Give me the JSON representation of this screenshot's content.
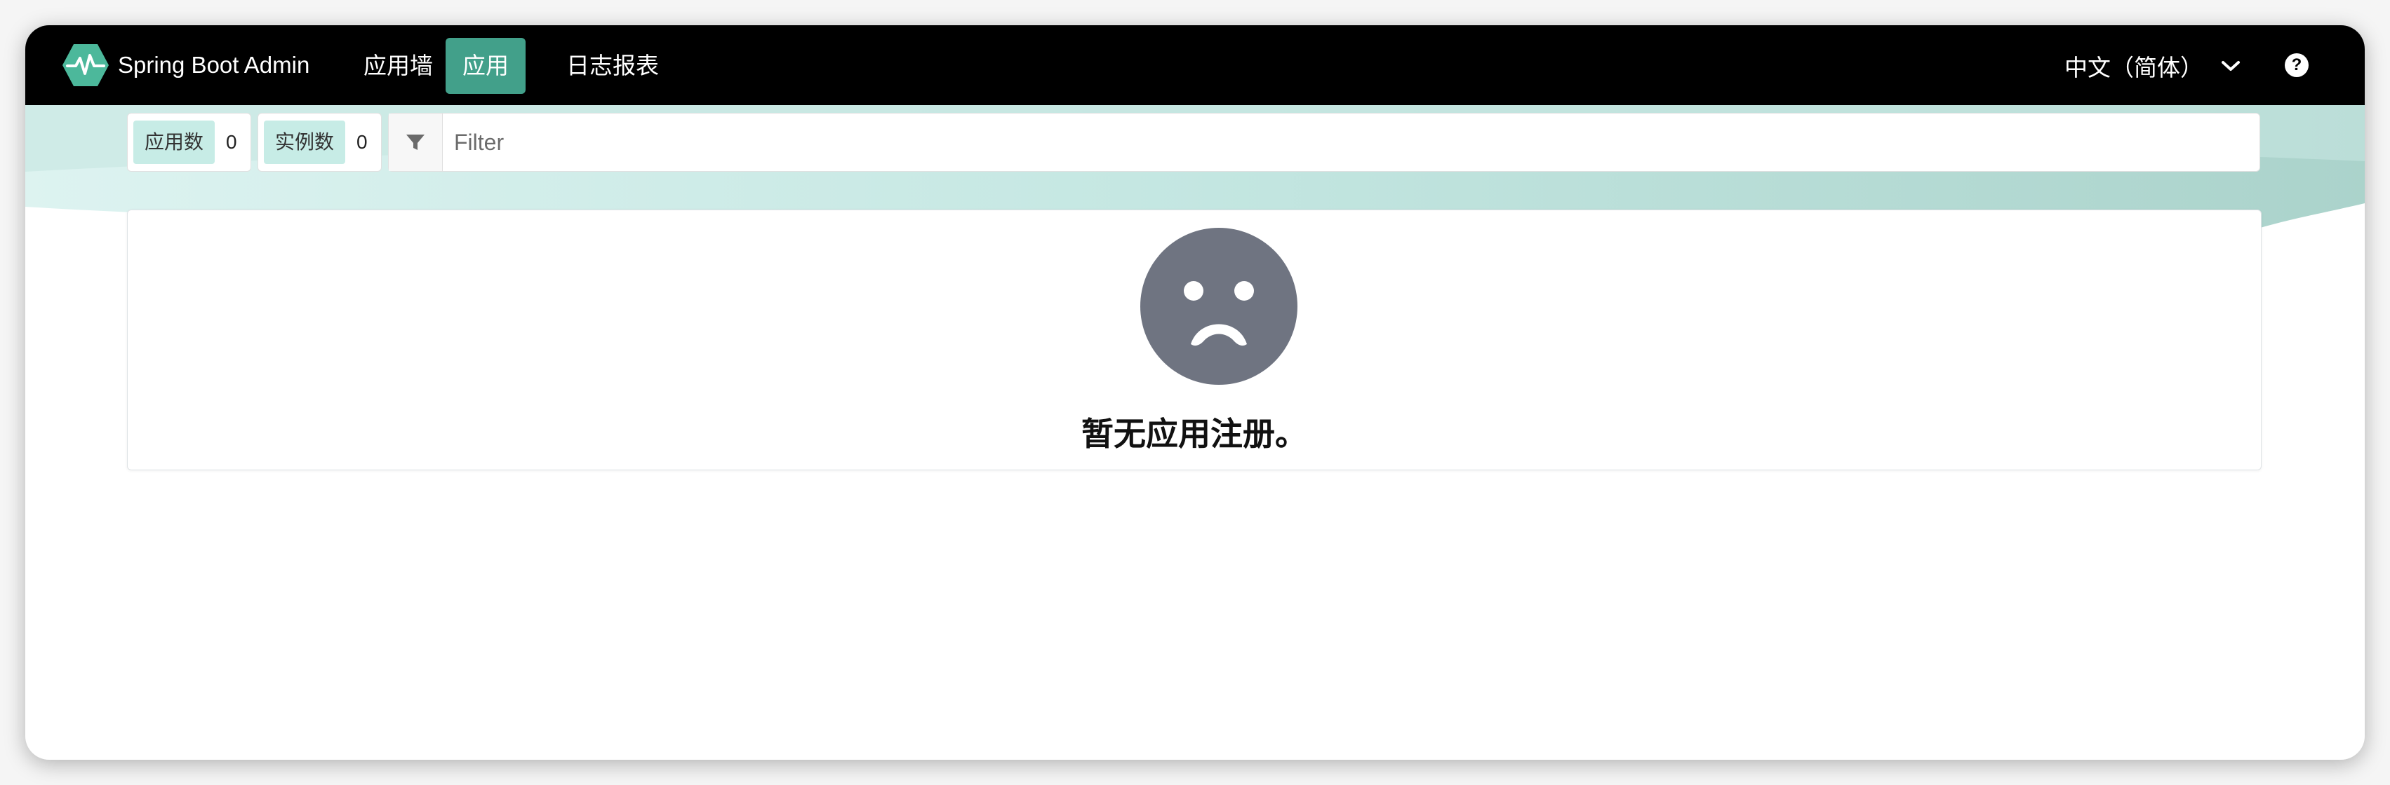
{
  "navbar": {
    "brand": "Spring Boot Admin",
    "items": [
      {
        "label": "应用墙",
        "active": false
      },
      {
        "label": "应用",
        "active": true
      },
      {
        "label": "日志报表",
        "active": false
      }
    ],
    "language": "中文（简体）",
    "help_symbol": "?"
  },
  "stats": {
    "apps_label": "应用数",
    "apps_count": "0",
    "instances_label": "实例数",
    "instances_count": "0"
  },
  "filter": {
    "placeholder": "Filter",
    "value": ""
  },
  "empty_state": {
    "message": "暂无应用注册。",
    "icon": "sad-face-icon"
  },
  "colors": {
    "navbar_bg": "#000000",
    "accent": "#42a08a",
    "tag_bg": "#c7ece6",
    "sad_face": "#6f7481"
  }
}
